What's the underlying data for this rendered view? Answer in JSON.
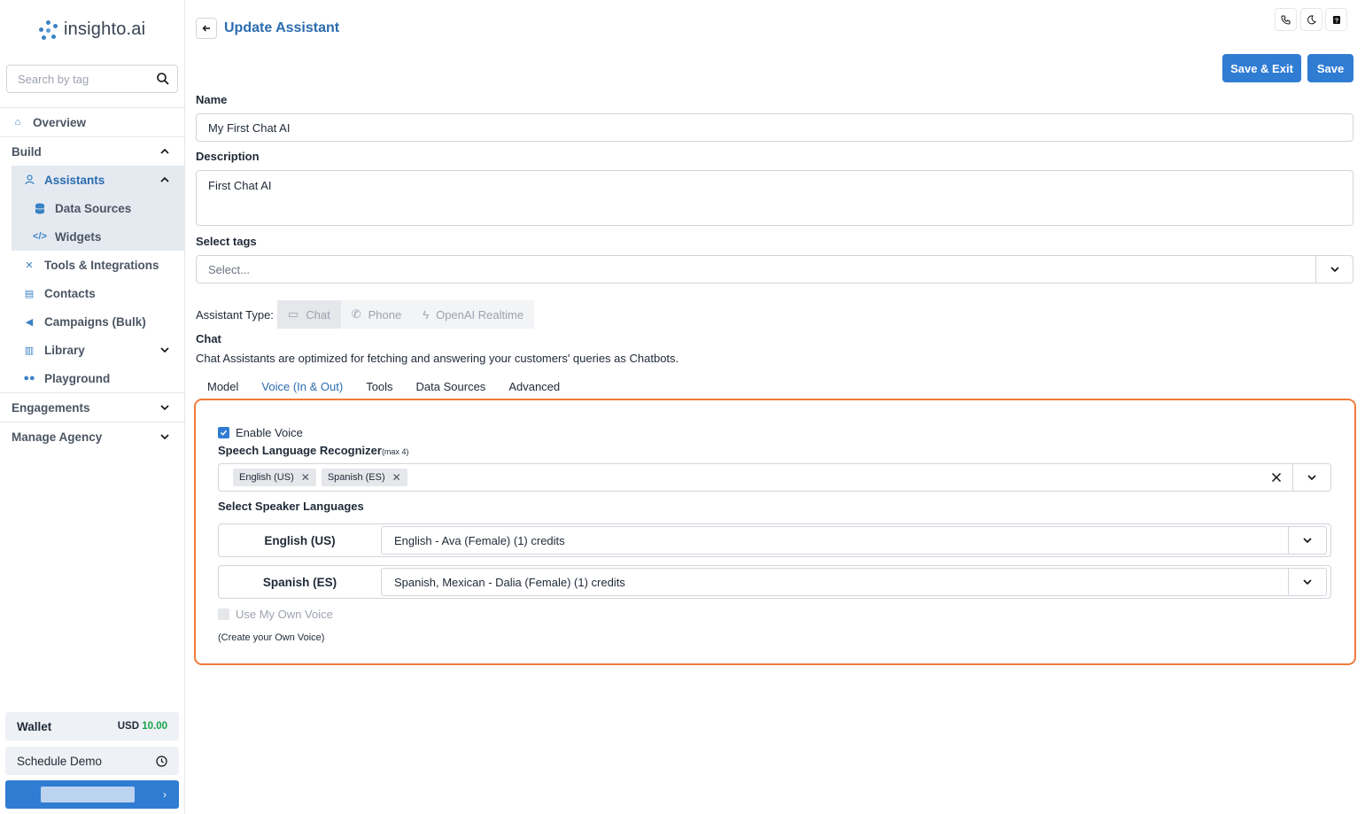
{
  "brand": {
    "logo_text": "insighto.ai",
    "accent": "#2f7cd3"
  },
  "sidebar": {
    "search_placeholder": "Search by tag",
    "overview": "Overview",
    "build": "Build",
    "assistants": "Assistants",
    "data_sources": "Data Sources",
    "widgets": "Widgets",
    "tools": "Tools & Integrations",
    "contacts": "Contacts",
    "campaigns": "Campaigns (Bulk)",
    "library": "Library",
    "playground": "Playground",
    "engagements": "Engagements",
    "manage_agency": "Manage Agency",
    "wallet_label": "Wallet",
    "wallet_currency": "USD",
    "wallet_amount": "10.00",
    "schedule_demo": "Schedule Demo"
  },
  "header": {
    "title": "Update Assistant",
    "save_exit": "Save & Exit",
    "save": "Save"
  },
  "form": {
    "name_label": "Name",
    "name_value": "My First Chat AI",
    "description_label": "Description",
    "description_value": "First Chat AI",
    "tags_label": "Select tags",
    "tags_placeholder": "Select...",
    "assistant_type_label": "Assistant Type:",
    "assistant_types": [
      "Chat",
      "Phone",
      "OpenAI Realtime"
    ],
    "chat_heading": "Chat",
    "chat_description": "Chat Assistants are optimized for fetching and answering your customers' queries as Chatbots."
  },
  "tabs": [
    "Model",
    "Voice (In & Out)",
    "Tools",
    "Data Sources",
    "Advanced"
  ],
  "voice": {
    "enable_voice": "Enable Voice",
    "recognizer_label": "Speech Language Recognizer",
    "recognizer_hint": "(max 4)",
    "recognizer_languages": [
      "English (US)",
      "Spanish (ES)"
    ],
    "speaker_heading": "Select Speaker Languages",
    "speakers": [
      {
        "language": "English (US)",
        "voice": "English - Ava (Female) (1) credits"
      },
      {
        "language": "Spanish (ES)",
        "voice": "Spanish, Mexican - Dalia (Female) (1) credits"
      }
    ],
    "own_voice": "Use My Own Voice",
    "create_voice": "(Create your Own Voice)"
  }
}
